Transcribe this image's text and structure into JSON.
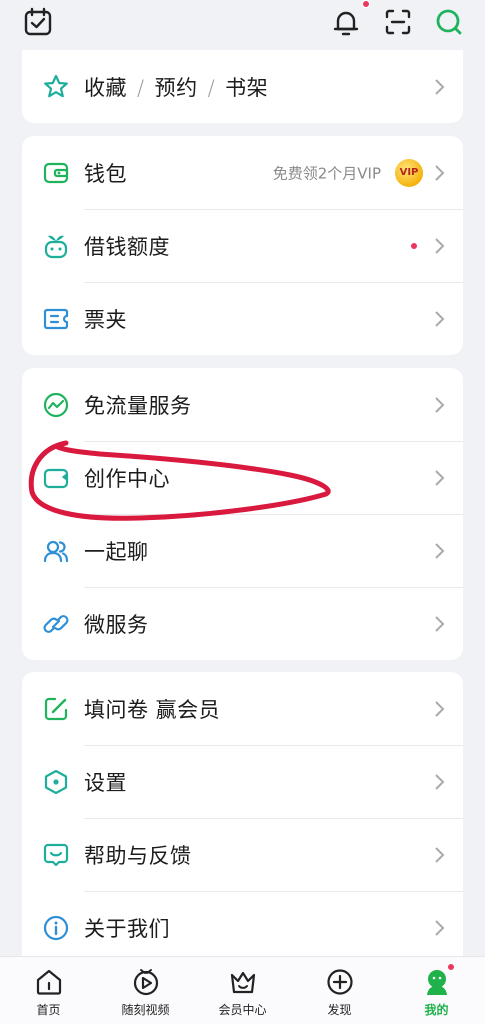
{
  "topbar": {
    "left_icon": "calendar-check-icon",
    "right_icons": [
      "bell-icon",
      "scan-icon",
      "search-icon"
    ],
    "accent": "#1fb35d"
  },
  "cards": [
    {
      "items": [
        {
          "icon": "star-icon",
          "label_parts": [
            "收藏",
            "预约",
            "书架"
          ],
          "separator": "/"
        }
      ]
    },
    {
      "items": [
        {
          "icon": "wallet-icon",
          "label": "钱包",
          "sub_text": "免费领2个月VIP",
          "badge": "VIP"
        },
        {
          "icon": "sprout-face-icon",
          "label": "借钱额度",
          "dot": true
        },
        {
          "icon": "ticket-icon",
          "label": "票夹"
        }
      ]
    },
    {
      "items": [
        {
          "icon": "trend-circle-icon",
          "label": "免流量服务"
        },
        {
          "icon": "video-camera-icon",
          "label": "创作中心"
        },
        {
          "icon": "people-icon",
          "label": "一起聊"
        },
        {
          "icon": "link-icon",
          "label": "微服务"
        }
      ]
    },
    {
      "items": [
        {
          "icon": "edit-square-icon",
          "label": "填问卷 赢会员"
        },
        {
          "icon": "hexagon-settings-icon",
          "label": "设置"
        },
        {
          "icon": "help-chat-icon",
          "label": "帮助与反馈"
        },
        {
          "icon": "info-icon",
          "label": "关于我们"
        }
      ]
    }
  ],
  "tabbar": {
    "tabs": [
      {
        "label": "首页",
        "icon": "home-icon"
      },
      {
        "label": "随刻视频",
        "icon": "play-circle-icon"
      },
      {
        "label": "会员中心",
        "icon": "crown-icon"
      },
      {
        "label": "发现",
        "icon": "plus-circle-icon"
      },
      {
        "label": "我的",
        "icon": "avatar-icon",
        "active": true
      }
    ]
  },
  "colors": {
    "icon_green": "#1fb35d",
    "icon_teal": "#1fae9c",
    "icon_blue": "#2e8fd6",
    "annotation_red": "#d9193d",
    "badge_red": "#e8385f"
  }
}
